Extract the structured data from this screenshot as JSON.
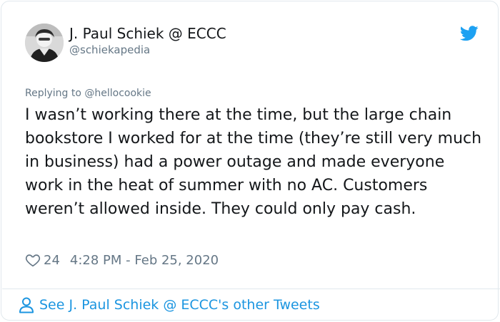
{
  "tweet": {
    "author": {
      "name": "J. Paul Schiek @ ECCC",
      "handle": "@schiekapedia",
      "avatar": "author-avatar-photo"
    },
    "brand_icon": "twitter-bird-icon",
    "reply": {
      "prefix": "Replying to",
      "handle": "@hellocookie"
    },
    "text": "I wasn’t working there at the time, but the large chain bookstore I worked for at the time (they’re still very much in business) had a power outage and made everyone work in the heat of summer with no AC. Customers weren’t allowed inside. They could only pay cash.",
    "likes": "24",
    "timestamp": "4:28 PM - Feb 25, 2020",
    "footer_link": "See J. Paul Schiek @ ECCC's other Tweets"
  },
  "colors": {
    "text": "#14171a",
    "secondary": "#657786",
    "link": "#1b95e0",
    "twitter_blue": "#1da1f2",
    "border": "#e1e8ed"
  }
}
